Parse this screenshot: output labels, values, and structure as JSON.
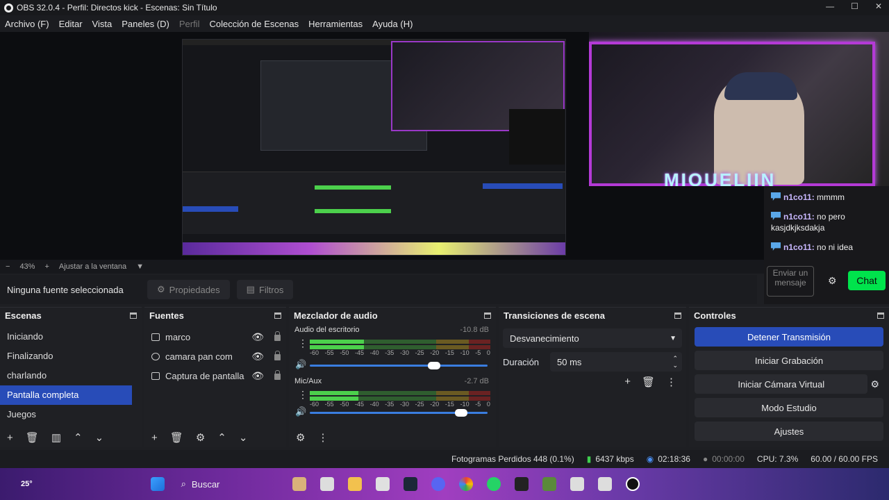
{
  "window": {
    "title": "OBS 32.0.4 - Perfil: Directos kick - Escenas: Sin Título"
  },
  "menu": [
    "Archivo (F)",
    "Editar",
    "Vista",
    "Paneles (D)",
    "Perfil",
    "Colección de Escenas",
    "Herramientas",
    "Ayuda (H)"
  ],
  "preview": {
    "streamer_name": "MIQUELIIN",
    "zoom": "43%",
    "fit_label": "Ajustar a la ventana"
  },
  "chat": {
    "messages": [
      {
        "user": "n1co11:",
        "text": "mmmm"
      },
      {
        "user": "n1co11:",
        "text": "no pero kasjdkjksdakja"
      },
      {
        "user": "n1co11:",
        "text": "no ni idea"
      }
    ],
    "input_placeholder": "Enviar un mensaje",
    "chat_button": "Chat",
    "accent": "#00e34c"
  },
  "source_toolbar": {
    "no_source": "Ninguna fuente seleccionada",
    "properties": "Propiedades",
    "filters": "Filtros"
  },
  "scenes": {
    "title": "Escenas",
    "items": [
      "Iniciando",
      "Finalizando",
      "charlando",
      "Pantalla completa",
      "Juegos"
    ],
    "selected": "Pantalla completa"
  },
  "sources": {
    "title": "Fuentes",
    "items": [
      "marco",
      "camara pan com",
      "Captura de pantalla"
    ]
  },
  "mixer": {
    "title": "Mezclador de audio",
    "channels": [
      {
        "name": "Audio del escritorio",
        "db": "-10.8 dB",
        "level": 0.3,
        "volume": 0.7
      },
      {
        "name": "Mic/Aux",
        "db": "-2.7 dB",
        "level": 0.27,
        "volume": 0.85
      }
    ],
    "ticks": [
      "-60",
      "-55",
      "-50",
      "-45",
      "-40",
      "-35",
      "-30",
      "-25",
      "-20",
      "-15",
      "-10",
      "-5",
      "0"
    ]
  },
  "transitions": {
    "title": "Transiciones de escena",
    "selected": "Desvanecimiento",
    "duration_label": "Duración",
    "duration_value": "50 ms"
  },
  "controls": {
    "title": "Controles",
    "buttons": [
      "Detener Transmisión",
      "Iniciar Grabación",
      "Iniciar Cámara Virtual",
      "Modo Estudio",
      "Ajustes"
    ]
  },
  "status": {
    "dropped": "Fotogramas Perdidos 448 (0.1%)",
    "bitrate": "6437 kbps",
    "stream_time": "02:18:36",
    "record_time": "00:00:00",
    "cpu": "CPU: 7.3%",
    "fps": "60.00 / 60.00 FPS"
  },
  "taskbar": {
    "search": "Buscar",
    "weather": "25°"
  }
}
